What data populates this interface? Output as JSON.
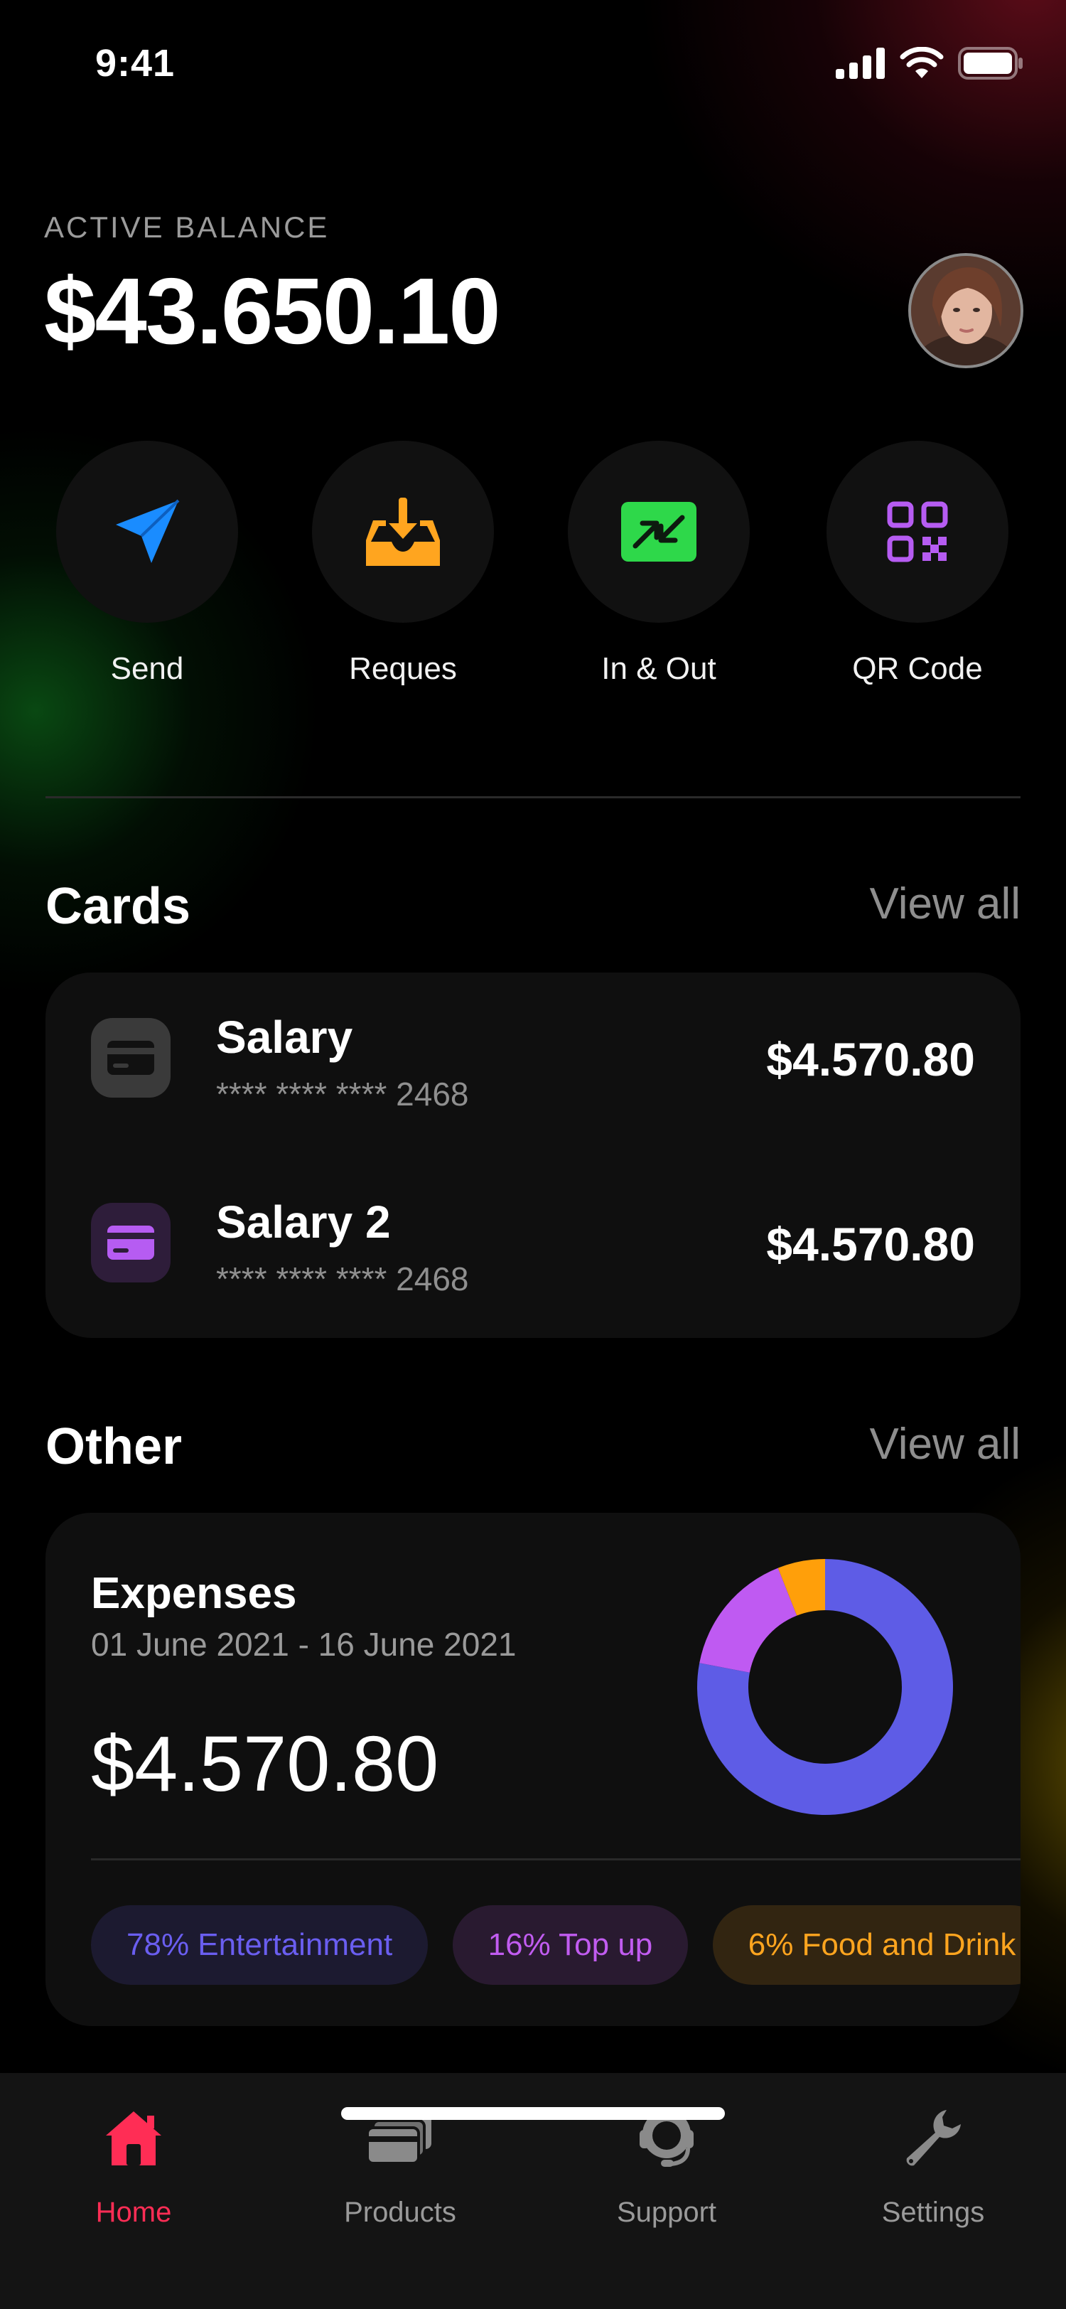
{
  "status_bar": {
    "time": "9:41"
  },
  "balance": {
    "label": "ACTIVE BALANCE",
    "amount": "$43.650.10"
  },
  "actions": [
    {
      "label": "Send",
      "icon": "paper-plane-icon",
      "color": "#1a8cff"
    },
    {
      "label": "Reques",
      "icon": "inbox-download-icon",
      "color": "#ffa51f"
    },
    {
      "label": "In & Out",
      "icon": "arrows-in-out-icon",
      "color": "#2ed84a"
    },
    {
      "label": "QR Code",
      "icon": "qr-code-icon",
      "color": "#b65cf2"
    }
  ],
  "cards_section": {
    "title": "Cards",
    "view_all": "View all",
    "cards": [
      {
        "name": "Salary",
        "mask": "**** **** ****",
        "last4": "2468",
        "amount": "$4.570.80",
        "icon": "card-icon",
        "color": "#3a3a3a"
      },
      {
        "name": "Salary 2",
        "mask": "**** **** ****",
        "last4": "2468",
        "amount": "$4.570.80",
        "icon": "card-icon",
        "color": "#b65cf2"
      }
    ]
  },
  "other_section": {
    "title": "Other",
    "view_all": "View all",
    "expenses": {
      "title": "Expenses",
      "range": "01 June 2021 - 16 June 2021",
      "amount": "$4.570.80",
      "chips": [
        {
          "label": "78% Entertainment",
          "color": "#6a5ef0"
        },
        {
          "label": "16% Top up",
          "color": "#c15cf0"
        },
        {
          "label": "6% Food and Drink",
          "color": "#ffa51f"
        }
      ]
    }
  },
  "chart_data": {
    "type": "pie",
    "categories": [
      "Entertainment",
      "Top up",
      "Food and Drink"
    ],
    "values": [
      78,
      16,
      6
    ],
    "colors": [
      "#5e5ce6",
      "#bf5af2",
      "#ff9f0a"
    ],
    "donut": true
  },
  "tab_bar": {
    "active_color": "#ff2d55",
    "tabs": [
      {
        "label": "Home",
        "icon": "home-icon",
        "active": true
      },
      {
        "label": "Products",
        "icon": "cards-stack-icon",
        "active": false
      },
      {
        "label": "Support",
        "icon": "headset-icon",
        "active": false
      },
      {
        "label": "Settings",
        "icon": "wrench-icon",
        "active": false
      }
    ]
  }
}
